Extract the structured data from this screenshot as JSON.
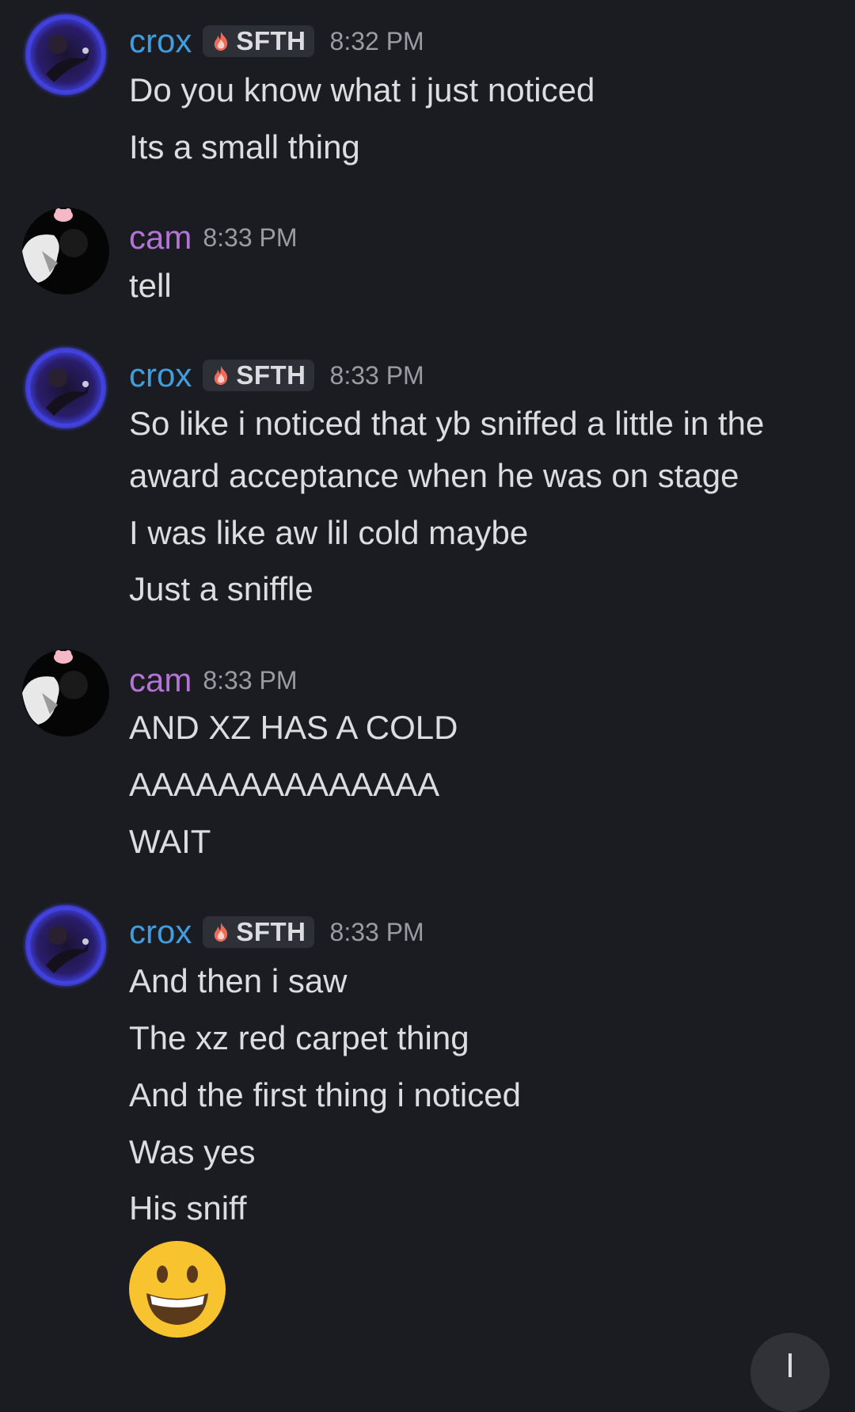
{
  "messages": [
    {
      "author": "crox",
      "tag": "SFTH",
      "time": "8:32 PM",
      "lines": [
        "Do you know what i just noticed",
        "Its a small thing"
      ]
    },
    {
      "author": "cam",
      "time": "8:33 PM",
      "lines": [
        "tell"
      ]
    },
    {
      "author": "crox",
      "tag": "SFTH",
      "time": "8:33 PM",
      "lines": [
        "So like i noticed that yb sniffed a little in the award acceptance when he was on stage",
        "I was like aw lil cold maybe",
        "Just a sniffle"
      ]
    },
    {
      "author": "cam",
      "time": "8:33 PM",
      "lines": [
        "AND XZ HAS A COLD",
        "AAAAAAAAAAAAAA",
        "WAIT"
      ]
    },
    {
      "author": "crox",
      "tag": "SFTH",
      "time": "8:33 PM",
      "lines": [
        "And then i saw",
        "The xz red carpet thing",
        "And the first thing i noticed",
        "Was yes",
        "His sniff"
      ],
      "emoji": "grinning-face"
    }
  ],
  "icons": {
    "tag_icon": "fire-icon",
    "scroll_button": "arrow-down-icon"
  },
  "colors": {
    "background": "#1b1c21",
    "crox_name": "#3f9de0",
    "cam_name": "#b573d8",
    "timestamp": "#9a9ca3",
    "message_text": "#dcdde1"
  }
}
